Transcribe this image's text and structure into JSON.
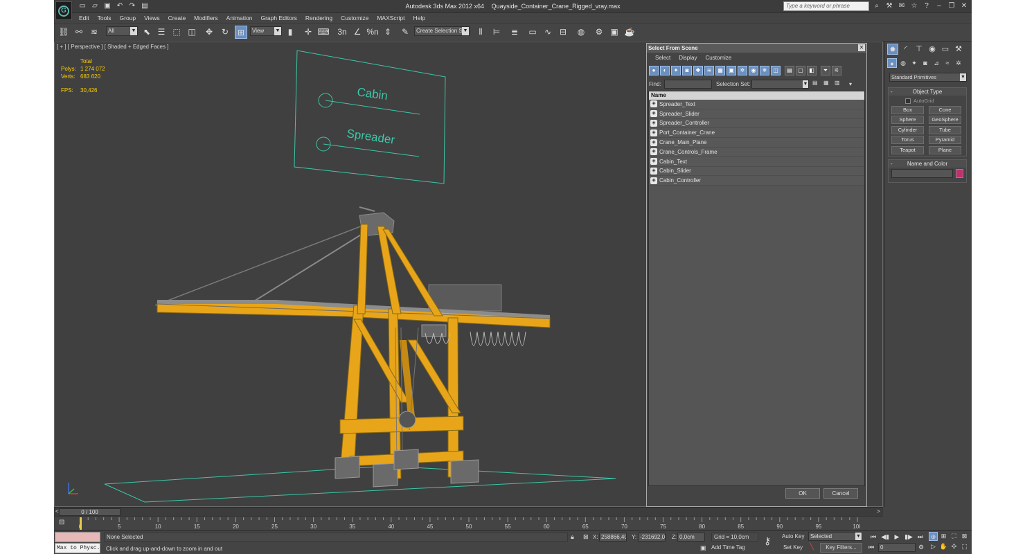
{
  "titlebar": {
    "app_name": "Autodesk 3ds Max  2012 x64",
    "file_name": "Quayside_Container_Crane_Rigged_vray.max",
    "search_placeholder": "Type a keyword or phrase",
    "logo_glyph": "G"
  },
  "menu": [
    "Edit",
    "Tools",
    "Group",
    "Views",
    "Create",
    "Modifiers",
    "Animation",
    "Graph Editors",
    "Rendering",
    "Customize",
    "MAXScript",
    "Help"
  ],
  "toolbar": {
    "selection_filter": "All",
    "ref_coord": "View",
    "named_selection": "Create Selection Se",
    "snap_label": "3n",
    "percent_snap": "%n"
  },
  "viewport": {
    "label": "[ + ] [ Perspective ] [ Shaded + Edged Faces ]",
    "stats_header": "Total",
    "polys_label": "Polys:",
    "polys_value": "1 274 072",
    "verts_label": "Verts:",
    "verts_value": "683 620",
    "fps_label": "FPS:",
    "fps_value": "30,426",
    "control_labels": [
      "Cabin",
      "Spreader"
    ],
    "colors": {
      "crane": "#e8a51a",
      "wire": "#3cc7a8",
      "bg": "#404040"
    }
  },
  "dialog": {
    "title": "Select From Scene",
    "menu": [
      "Select",
      "Display",
      "Customize"
    ],
    "find_label": "Find:",
    "selection_set_label": "Selection Set:",
    "column_name": "Name",
    "items": [
      "Spreader_Text",
      "Spreader_Slider",
      "Spreader_Controller",
      "Port_Container_Crane",
      "Crane_Main_Plane",
      "Crane_Controls_Frame",
      "Cabin_Text",
      "Cabin_Slider",
      "Cabin_Controller"
    ],
    "ok_label": "OK",
    "cancel_label": "Cancel"
  },
  "command_panel": {
    "category": "Standard Primitives",
    "object_type_title": "Object Type",
    "autogrid_label": "AutoGrid",
    "primitives": [
      "Box",
      "Cone",
      "Sphere",
      "GeoSphere",
      "Cylinder",
      "Tube",
      "Torus",
      "Pyramid",
      "Teapot",
      "Plane"
    ],
    "name_color_title": "Name and Color",
    "object_color": "#c0306f"
  },
  "timeline": {
    "slider_text": "0 / 100",
    "ruler_ticks": [
      "0",
      "5",
      "10",
      "15",
      "20",
      "25",
      "30",
      "35",
      "40",
      "45",
      "50",
      "55",
      "60",
      "65",
      "70",
      "75",
      "80",
      "85",
      "90",
      "95",
      "100"
    ]
  },
  "status": {
    "maxscript_listener": "Max to Physc.",
    "selection_status": "None Selected",
    "prompt": "Click and drag up-and-down to zoom in and out",
    "x_label": "X:",
    "x_value": "258866,40",
    "y_label": "Y:",
    "y_value": "-231692,0",
    "z_label": "Z:",
    "z_value": "0,0cm",
    "grid": "Grid = 10,0cm",
    "add_time_tag": "Add Time Tag",
    "auto_key": "Auto Key",
    "set_key": "Set Key",
    "key_mode": "Selected",
    "key_filters": "Key Filters...",
    "frame": "0"
  }
}
